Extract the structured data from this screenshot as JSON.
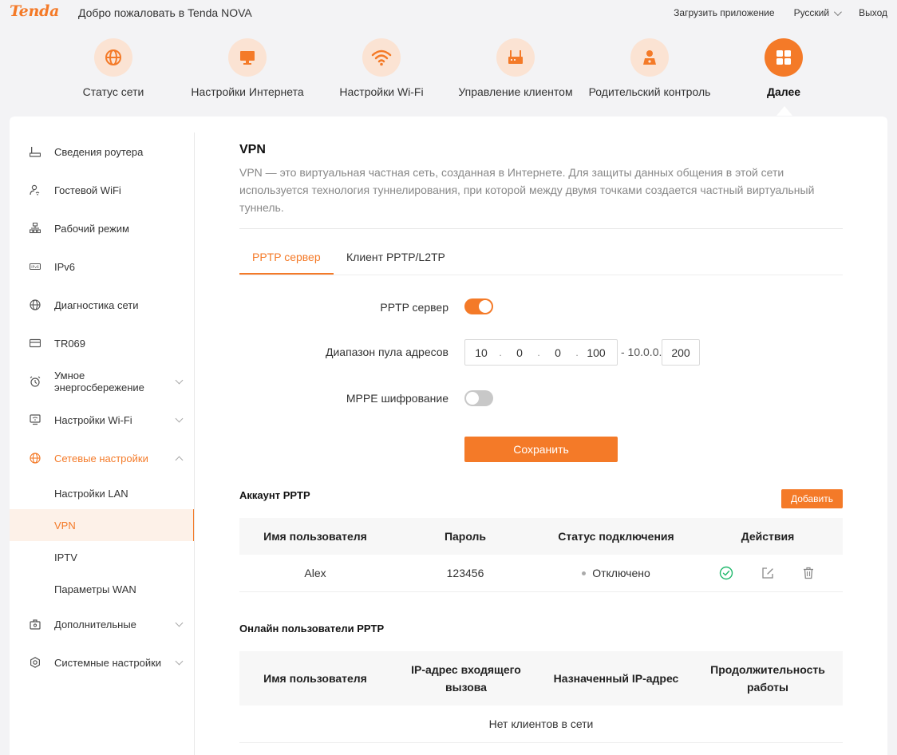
{
  "header": {
    "logo": "Tenda",
    "welcome": "Добро пожаловать в Tenda NOVA",
    "download_app": "Загрузить приложение",
    "language": "Русский",
    "logout": "Выход"
  },
  "main_nav": [
    {
      "label": "Статус сети",
      "icon": "globe-icon"
    },
    {
      "label": "Настройки Интернета",
      "icon": "monitor-icon"
    },
    {
      "label": "Настройки Wi-Fi",
      "icon": "wifi-icon"
    },
    {
      "label": "Управление клиентом",
      "icon": "router-icon"
    },
    {
      "label": "Родительский контроль",
      "icon": "parent-icon"
    },
    {
      "label": "Далее",
      "icon": "grid-icon",
      "active": true
    }
  ],
  "sidebar": {
    "items": [
      {
        "label": "Сведения роутера",
        "icon": "router-info-icon"
      },
      {
        "label": "Гостевой WiFi",
        "icon": "guest-wifi-icon"
      },
      {
        "label": "Рабочий режим",
        "icon": "work-mode-icon"
      },
      {
        "label": "IPv6",
        "icon": "ipv6-icon"
      },
      {
        "label": "Диагностика сети",
        "icon": "globe-icon"
      },
      {
        "label": "TR069",
        "icon": "tr069-icon"
      },
      {
        "label": "Умное энергосбережение",
        "icon": "alarm-icon"
      },
      {
        "label": "Настройки Wi-Fi",
        "icon": "wifi-settings-icon"
      },
      {
        "label": "Сетевые настройки",
        "icon": "globe-icon"
      },
      {
        "label": "Дополнительные",
        "icon": "toolbox-icon"
      },
      {
        "label": "Системные настройки",
        "icon": "gear-icon"
      }
    ],
    "subitems": [
      {
        "label": "Настройки LAN"
      },
      {
        "label": "VPN",
        "active": true
      },
      {
        "label": "IPTV"
      },
      {
        "label": "Параметры WAN"
      }
    ]
  },
  "page": {
    "title": "VPN",
    "description": "VPN — это виртуальная частная сеть, созданная в Интернете. Для защиты данных общения в этой сети используется технология туннелирования, при которой между двумя точками создается частный виртуальный туннель.",
    "tabs": [
      "PPTP сервер",
      "Клиент PPTP/L2TP"
    ],
    "active_tab": "PPTP сервер"
  },
  "form": {
    "pptp_server_label": "PPTP сервер",
    "pptp_server_enabled": true,
    "pool_label": "Диапазон пула адресов",
    "pool_start": [
      "10",
      "0",
      "0",
      "100"
    ],
    "pool_end_prefix": "- 10.0.0.",
    "pool_end": "200",
    "mppe_label": "MPPE шифрование",
    "mppe_enabled": false,
    "save_label": "Сохранить"
  },
  "accounts": {
    "title": "Аккаунт PPTP",
    "add_label": "Добавить",
    "headers": [
      "Имя пользователя",
      "Пароль",
      "Статус подключения",
      "Действия"
    ],
    "rows": [
      {
        "username": "Alex",
        "password": "123456",
        "status": "Отключено"
      }
    ]
  },
  "online": {
    "title": "Онлайн пользователи PPTP",
    "headers": [
      "Имя пользователя",
      "IP-адрес входящего вызова",
      "Назначенный IP-адрес",
      "Продолжительность работы"
    ],
    "empty_text": "Нет клиентов в сети"
  },
  "colors": {
    "accent": "#f47a28",
    "accent_light": "#fbe3d3",
    "success": "#1fb86b"
  }
}
